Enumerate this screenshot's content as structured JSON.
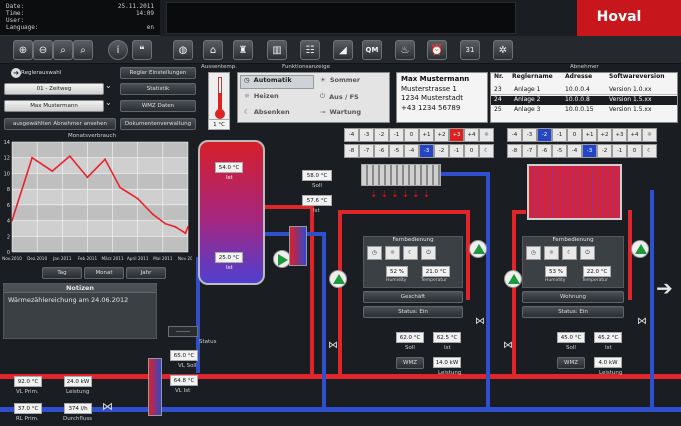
{
  "header": {
    "info_rows": [
      {
        "label": "Date:",
        "value": "25.11.2011"
      },
      {
        "label": "Time:",
        "value": "14:09"
      },
      {
        "label": "User:",
        "value": ""
      },
      {
        "label": "Language:",
        "value": "en"
      }
    ],
    "logo": "Hoval"
  },
  "toolbar": {
    "icons": [
      "zoom-in-icon",
      "zoom-out-icon",
      "zoom-reset-icon",
      "zoom-fit-icon",
      "info-icon",
      "chat-icon",
      "globe-icon",
      "home-icon",
      "boiler-icon",
      "radiator-icon",
      "distributor-icon",
      "solar-icon",
      "qm-icon",
      "heat-icon",
      "alarm-icon",
      "calendar-icon",
      "settings-icon"
    ],
    "qm_label": "QM",
    "calendar_label": "31"
  },
  "left": {
    "regler_label": "Reglerauswahl",
    "regler_settings": "Regler Einstellungen",
    "zeitweg_select": "01 - Zeitweg",
    "statistik": "Statistik",
    "user_select": "Max Mustermann",
    "wmz_daten": "WMZ Daten",
    "abnehmer_button": "ausgewählten Abnehmer ansehen",
    "dokumenten": "Dokumentenverwaltung"
  },
  "outdoor": {
    "title": "Aussentemp.",
    "value": "1 °C"
  },
  "functions": {
    "title": "Funktionsanzeige",
    "items": [
      {
        "icon": "clock-icon",
        "label": "Automatik",
        "active": true
      },
      {
        "icon": "sun-icon",
        "label": "Sommer",
        "active": false
      },
      {
        "icon": "sun-icon",
        "label": "Heizen",
        "active": false
      },
      {
        "icon": "power-icon",
        "label": "Aus / FS",
        "active": false
      },
      {
        "icon": "moon-icon",
        "label": "Absenken",
        "active": false
      },
      {
        "icon": "wrench-icon",
        "label": "Wartung",
        "active": false
      }
    ]
  },
  "contact": {
    "name": "Max Mustermann",
    "street": "Musterstrasse 1",
    "city": "1234 Musterstadt",
    "phone": "+43 1234 56789"
  },
  "abnehmer": {
    "title": "Abnehmer",
    "headers": [
      "Nr.",
      "Reglername",
      "Adresse",
      "Softwareversion"
    ],
    "rows": [
      {
        "nr": "23",
        "name": "Anlage 1",
        "addr": "10.0.0.4",
        "ver": "Version 1.0.xx",
        "selected": false
      },
      {
        "nr": "24",
        "name": "Anlage 2",
        "addr": "10.0.0.8",
        "ver": "Version 1.5.xx",
        "selected": true
      },
      {
        "nr": "25",
        "name": "Anlage 3",
        "addr": "10.0.0.15",
        "ver": "Version 1.5.xx",
        "selected": false
      }
    ]
  },
  "chart_data": {
    "type": "line",
    "title": "Monatsverbrauch",
    "categories": [
      "Nov.2010",
      "Dez.2010",
      "Jan 2011",
      "Feb 2011",
      "März 2011",
      "April 2011",
      "Mai 2011",
      "Nov 2011"
    ],
    "y_ticks": [
      "14",
      "12",
      "10",
      "8",
      "6",
      "4",
      "2",
      "0"
    ],
    "ylim": [
      0,
      14
    ],
    "x": [
      0,
      0.8,
      1.6,
      2.3,
      3,
      3.7,
      4.3,
      5,
      5.6,
      6.1,
      6.5,
      6.9,
      7
    ],
    "values": [
      4,
      12,
      10.3,
      12.2,
      9.5,
      11.8,
      8.2,
      6.8,
      4.8,
      3.6,
      3.2,
      2.4,
      3.2
    ],
    "color": "#e8222a",
    "grid": true
  },
  "chart_tabs": [
    "Tag",
    "Monat",
    "Jahr"
  ],
  "notes": {
    "title": "Notizen",
    "text": "Wärmezählereichung am 24.06.2012"
  },
  "storage": {
    "top_value": "54.0 °C",
    "top_label": "Ist",
    "bottom_value": "25.0 °C",
    "bottom_label": "Ist"
  },
  "storage_right": {
    "soll_value": "58.0 °C",
    "soll_label": "Soll",
    "ist_value": "57.6 °C",
    "ist_label": "Ist"
  },
  "status_block": {
    "value": "-------",
    "label": "Status",
    "vl_soll_value": "65.0 °C",
    "vl_soll_label": "VL Soll",
    "vl_ist_value": "64.8 °C",
    "vl_ist_label": "VL Ist"
  },
  "primary": {
    "vl_value": "92.0 °C",
    "vl_label": "VL Prim.",
    "leistung_value": "24.0 kW",
    "leistung_label": "Leistung",
    "rl_value": "37.0 °C",
    "rl_label": "RL Prim.",
    "flow_value": "374 l/h",
    "flow_label": "Durchfluss"
  },
  "zone1": {
    "grid_top": [
      "-4",
      "-3",
      "-2",
      "-1",
      "0",
      "+1",
      "+2",
      "+3",
      "+4"
    ],
    "grid_bottom": [
      "-8",
      "-7",
      "-6",
      "-5",
      "-4",
      "-3",
      "-2",
      "-1",
      "0"
    ],
    "remote_title": "Fernbedienung",
    "humidity": "52 %",
    "humidity_label": "Humidity",
    "temperature": "21.0 °C",
    "temperature_label": "Temperatur",
    "room": "Geschäft",
    "status": "Status: Ein",
    "soll_value": "62.0 °C",
    "soll_label": "Soll",
    "ist_value": "62.5 °C",
    "ist_label": "Ist",
    "wmz": "WMZ",
    "leistung_value": "14.0 kW",
    "leistung_label": "Leistung"
  },
  "zone2": {
    "grid_top": [
      "-4",
      "-3",
      "-2",
      "-1",
      "0",
      "+1",
      "+2",
      "+3",
      "+4"
    ],
    "grid_bottom": [
      "-8",
      "-7",
      "-6",
      "-5",
      "-4",
      "-3",
      "-2",
      "-1",
      "0"
    ],
    "remote_title": "Fernbedienung",
    "humidity": "53 %",
    "humidity_label": "Humidity",
    "temperature": "22.0 °C",
    "temperature_label": "Temperatur",
    "room": "Wohnung",
    "status": "Status: Ein",
    "soll_value": "45.0 °C",
    "soll_label": "Soll",
    "ist_value": "45.2 °C",
    "ist_label": "Ist",
    "wmz": "WMZ",
    "leistung_value": "4.0 kW",
    "leistung_label": "Leistung"
  }
}
